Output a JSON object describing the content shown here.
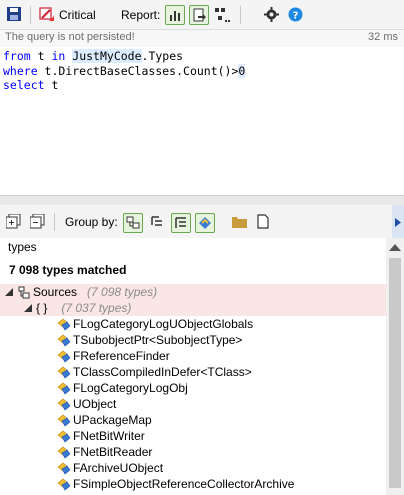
{
  "toolbar": {
    "critical_label": "Critical",
    "report_label": "Report:",
    "icons": [
      "save-icon",
      "critical-rule-icon",
      "report-chart-icon",
      "report-export-icon",
      "report-graph-icon",
      "settings-gear-icon",
      "help-icon"
    ]
  },
  "status": {
    "message": "The query is not persisted!",
    "elapsed": "32 ms"
  },
  "editor": {
    "lines": [
      [
        {
          "t": "from",
          "k": "kw"
        },
        {
          "t": " t ",
          "k": "plain"
        },
        {
          "t": "in",
          "k": "kw"
        },
        {
          "t": " ",
          "k": "plain"
        },
        {
          "t": "JustMyCode",
          "k": "hl"
        },
        {
          "t": ".Types",
          "k": "plain"
        }
      ],
      [
        {
          "t": "where",
          "k": "kw"
        },
        {
          "t": " t.DirectBaseClasses.Count()>",
          "k": "plain"
        },
        {
          "t": "0",
          "k": "hl"
        }
      ],
      [
        {
          "t": "select",
          "k": "kw"
        },
        {
          "t": " t",
          "k": "plain"
        }
      ]
    ]
  },
  "group_toolbar": {
    "group_by_label": "Group by:"
  },
  "search": {
    "value": "types"
  },
  "results": {
    "summary": "7 098 types matched",
    "root": {
      "label": "Sources",
      "count": "(7 098 types)"
    },
    "namespace": {
      "label": "{ }",
      "count": "(7 037 types)"
    },
    "items": [
      "FLogCategoryLogUObjectGlobals",
      "TSubobjectPtr<SubobjectType>",
      "FReferenceFinder",
      "TClassCompiledInDefer<TClass>",
      "FLogCategoryLogObj",
      "UObject",
      "UPackageMap",
      "FNetBitWriter",
      "FNetBitReader",
      "FArchiveUObject",
      "FSimpleObjectReferenceCollectorArchive"
    ]
  },
  "colors": {
    "keyword": "#0000ff",
    "highlight": "#ddebff",
    "matched_row": "#fbe6e6",
    "toggle_border": "#6aa84f"
  }
}
